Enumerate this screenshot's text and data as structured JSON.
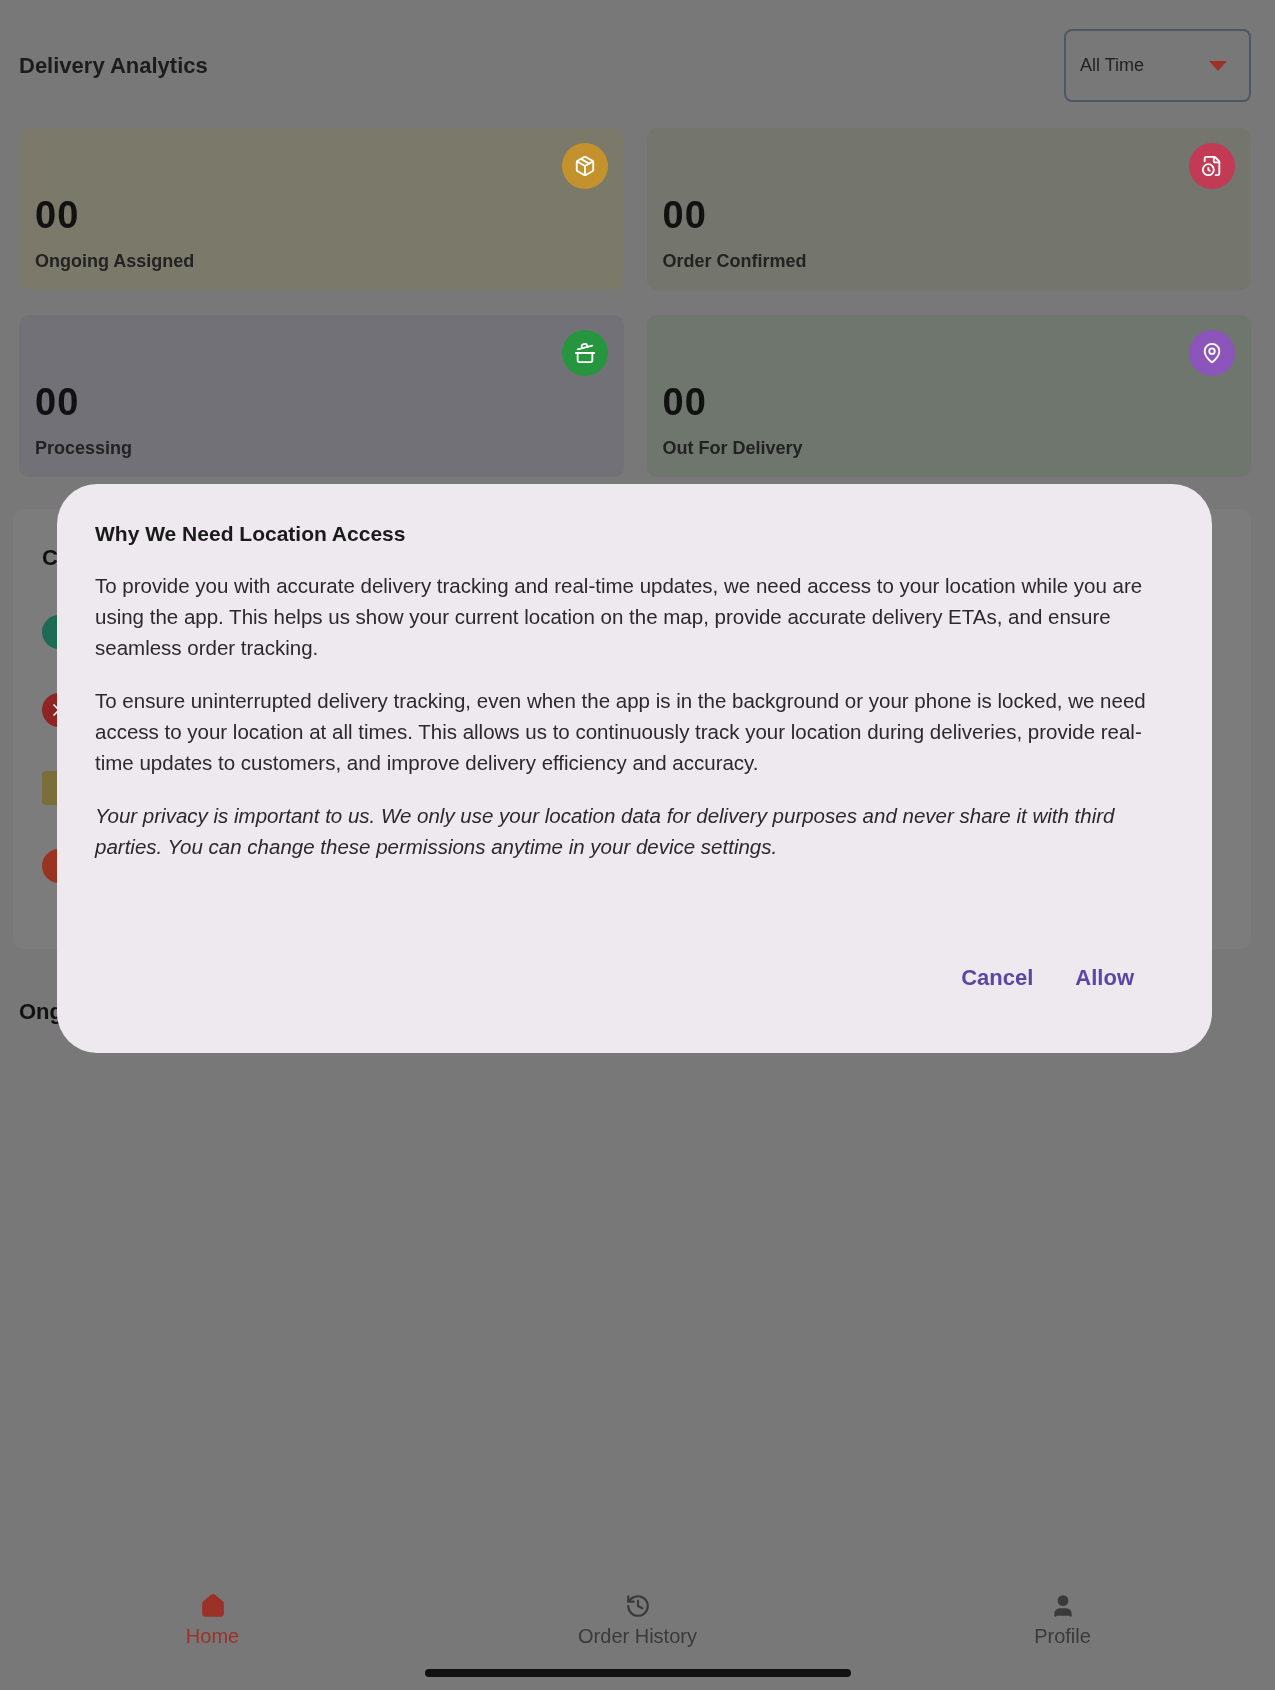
{
  "header": {
    "title": "Delivery Analytics",
    "filter": {
      "value": "All Time"
    }
  },
  "stats": [
    {
      "value": "00",
      "label": "Ongoing Assigned",
      "kind": "assigned",
      "color": "#c4922c"
    },
    {
      "value": "00",
      "label": "Order Confirmed",
      "kind": "confirmed",
      "color": "#c23a53"
    },
    {
      "value": "00",
      "label": "Processing",
      "kind": "processing",
      "color": "#25963e"
    },
    {
      "value": "00",
      "label": "Out For Delivery",
      "kind": "delivery",
      "color": "#8b55bb"
    }
  ],
  "hidden_section": {
    "heading": "C"
  },
  "ongoing_heading": "Ong",
  "dialog": {
    "title": "Why We Need Location Access",
    "paragraphs": [
      {
        "text": "To provide you with accurate delivery tracking and real-time updates, we need access to your location while you are using the app. This helps us show your current location on the map, provide accurate delivery ETAs, and ensure seamless order tracking.",
        "italic": false
      },
      {
        "text": "To ensure uninterrupted delivery tracking, even when the app is in the background or your phone is locked, we need access to your location at all times. This allows us to continuously track your location during deliveries, provide real-time updates to customers, and improve delivery efficiency and accuracy.",
        "italic": false
      },
      {
        "text": "Your privacy is important to us. We only use your location data for delivery purposes and never share it with third parties. You can change these permissions anytime in your device settings.",
        "italic": true
      }
    ],
    "buttons": [
      "Cancel",
      "Allow"
    ]
  },
  "nav": [
    {
      "label": "Home",
      "kind": "home",
      "selected": true
    },
    {
      "label": "Order History",
      "kind": "history",
      "selected": false
    },
    {
      "label": "Profile",
      "kind": "profile",
      "selected": false
    }
  ]
}
